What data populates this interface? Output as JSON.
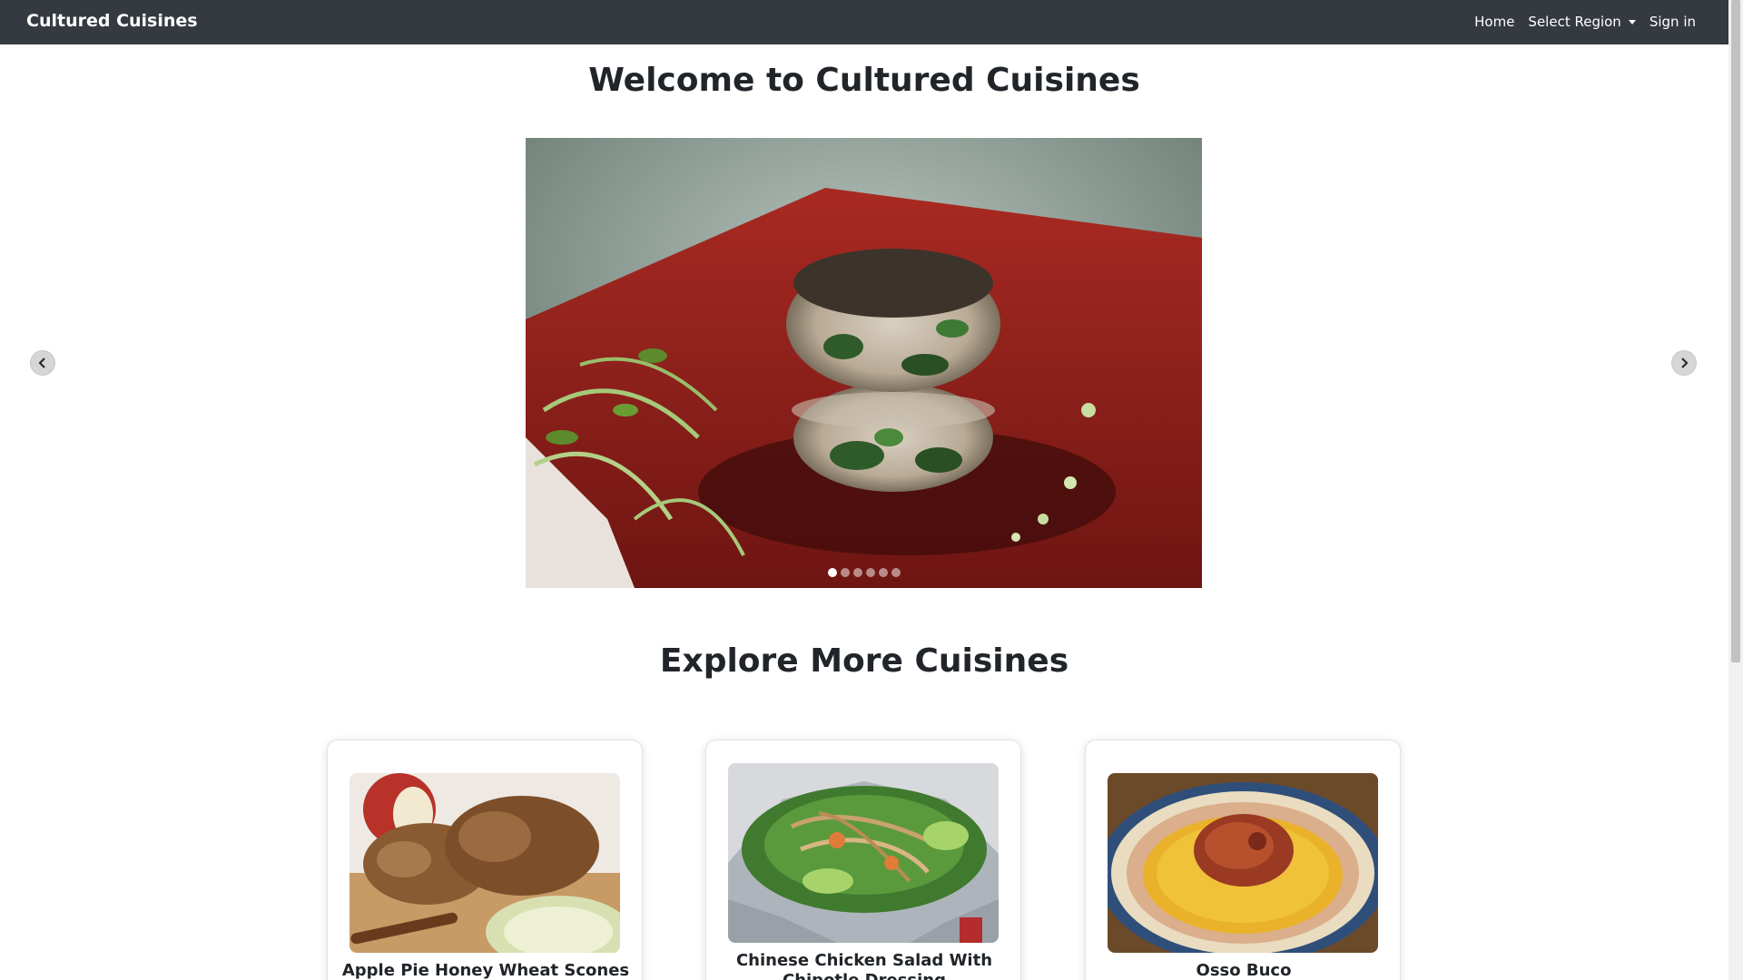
{
  "navbar": {
    "brand": "Cultured Cuisines",
    "links": [
      {
        "label": "Home"
      },
      {
        "label": "Select Region"
      },
      {
        "label": "Sign in"
      }
    ]
  },
  "hero": {
    "title": "Welcome to Cultured Cuisines",
    "slide_count": 6,
    "active_slide": 1
  },
  "explore": {
    "title": "Explore More Cuisines",
    "cards": [
      {
        "title": "Apple Pie Honey Wheat Scones"
      },
      {
        "title": "Chinese Chicken Salad With Chipotle Dressing"
      },
      {
        "title": "Osso Buco"
      }
    ]
  },
  "icons": {
    "prev": "chevron-left-icon",
    "next": "chevron-right-icon",
    "dropdown": "caret-down-icon"
  },
  "colors": {
    "navbar_bg": "#343a40",
    "text": "#212529"
  }
}
